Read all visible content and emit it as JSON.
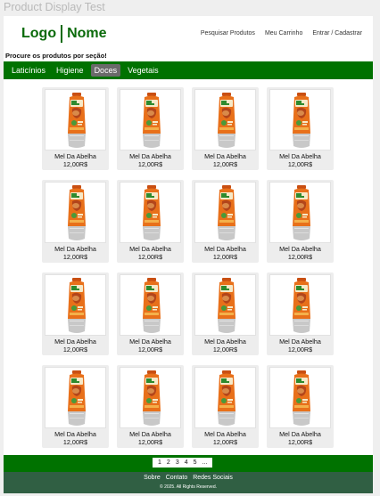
{
  "window": {
    "title": "Product Display Test"
  },
  "header": {
    "logo_left": "Logo",
    "logo_right": "Nome",
    "nav": [
      "Pesquisar Produtos",
      "Meu Carrinho",
      "Entrar / Cadastrar"
    ]
  },
  "prompt": "Procure os produtos por seção!",
  "categories": [
    {
      "label": "Laticínios",
      "active": false
    },
    {
      "label": "Higiene",
      "active": false
    },
    {
      "label": "Doces",
      "active": true
    },
    {
      "label": "Vegetais",
      "active": false
    }
  ],
  "products": [
    {
      "name": "Mel Da Abelha",
      "price": "12,00R$"
    },
    {
      "name": "Mel Da Abelha",
      "price": "12,00R$"
    },
    {
      "name": "Mel Da Abelha",
      "price": "12,00R$"
    },
    {
      "name": "Mel Da Abelha",
      "price": "12,00R$"
    },
    {
      "name": "Mel Da Abelha",
      "price": "12,00R$"
    },
    {
      "name": "Mel Da Abelha",
      "price": "12,00R$"
    },
    {
      "name": "Mel Da Abelha",
      "price": "12,00R$"
    },
    {
      "name": "Mel Da Abelha",
      "price": "12,00R$"
    },
    {
      "name": "Mel Da Abelha",
      "price": "12,00R$"
    },
    {
      "name": "Mel Da Abelha",
      "price": "12,00R$"
    },
    {
      "name": "Mel Da Abelha",
      "price": "12,00R$"
    },
    {
      "name": "Mel Da Abelha",
      "price": "12,00R$"
    },
    {
      "name": "Mel Da Abelha",
      "price": "12,00R$"
    },
    {
      "name": "Mel Da Abelha",
      "price": "12,00R$"
    },
    {
      "name": "Mel Da Abelha",
      "price": "12,00R$"
    },
    {
      "name": "Mel Da Abelha",
      "price": "12,00R$"
    }
  ],
  "pagination": [
    "1",
    "2",
    "3",
    "4",
    "5",
    "..."
  ],
  "footer": {
    "links": [
      "Sobre",
      "Contato",
      "Redes Sociais"
    ],
    "copyright": "© 2025. All Rights Reserved."
  },
  "colors": {
    "brand_green": "#007200",
    "footer_dark": "#305f43",
    "active_tab": "#6a6a6a",
    "honey": "#e8701a"
  },
  "icons": {
    "product_image": "honey-bottle-icon"
  }
}
